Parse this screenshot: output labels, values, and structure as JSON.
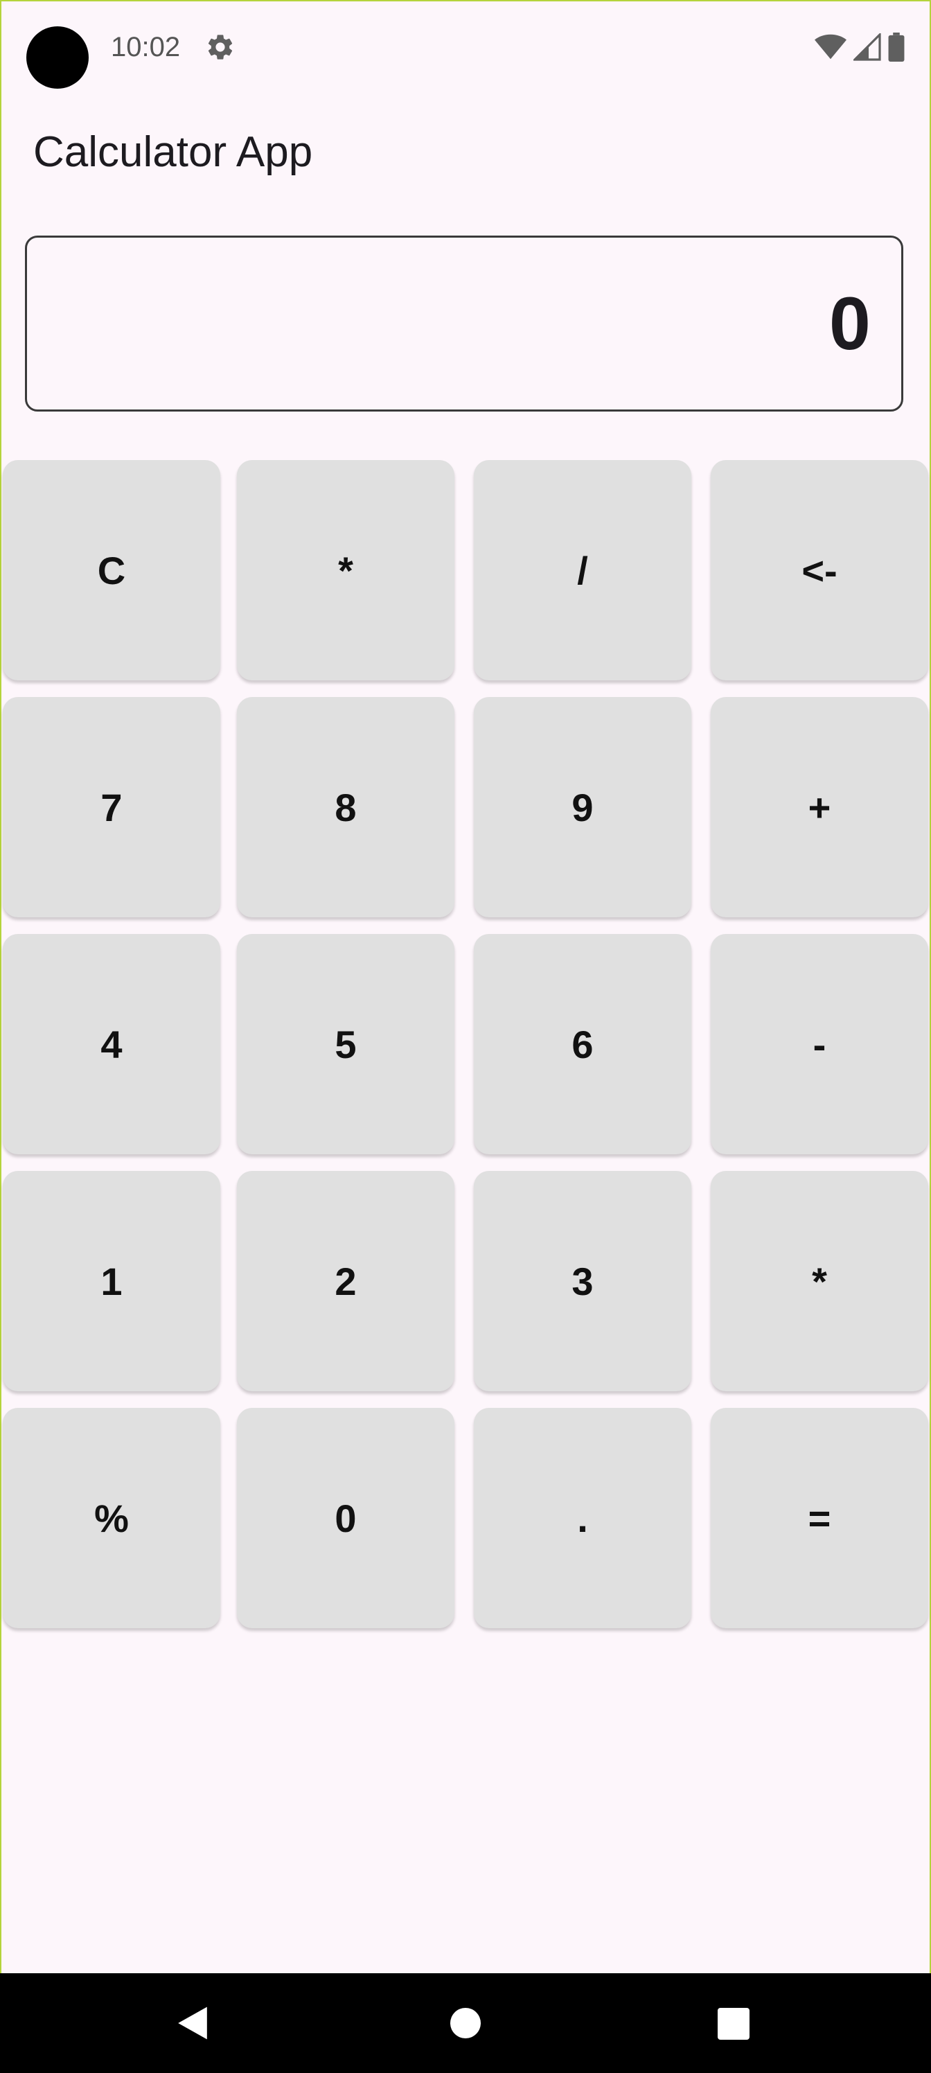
{
  "status_bar": {
    "time": "10:02",
    "icons": [
      "settings-icon",
      "wifi-icon",
      "signal-icon",
      "battery-icon"
    ]
  },
  "app": {
    "title": "Calculator App"
  },
  "display": {
    "value": "0"
  },
  "keypad": {
    "rows": [
      [
        "C",
        "*",
        "/",
        "<-"
      ],
      [
        "7",
        "8",
        "9",
        "+"
      ],
      [
        "4",
        "5",
        "6",
        "-"
      ],
      [
        "1",
        "2",
        "3",
        "*"
      ],
      [
        "%",
        "0",
        ".",
        "="
      ]
    ]
  },
  "nav_bar": {
    "icons": [
      "back-icon",
      "home-icon",
      "recents-icon"
    ]
  },
  "colors": {
    "background": "#fdf6fb",
    "key_background": "#e0e0e0",
    "frame_border": "#b5d43c",
    "nav_background": "#000000"
  }
}
